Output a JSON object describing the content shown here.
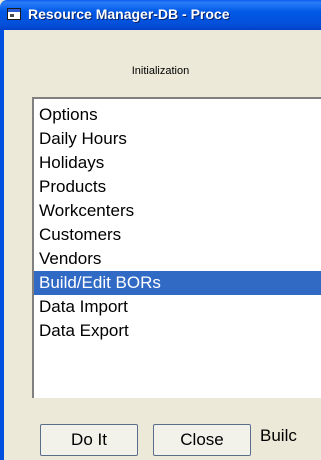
{
  "window": {
    "title": "Resource Manager-DB - Proce",
    "app_icon": "window-app-icon"
  },
  "header": {
    "label": "Initialization"
  },
  "list": {
    "items": [
      {
        "label": "Options",
        "selected": false
      },
      {
        "label": "Daily Hours",
        "selected": false
      },
      {
        "label": "Holidays",
        "selected": false
      },
      {
        "label": "Products",
        "selected": false
      },
      {
        "label": "Workcenters",
        "selected": false
      },
      {
        "label": "Customers",
        "selected": false
      },
      {
        "label": "Vendors",
        "selected": false
      },
      {
        "label": "Build/Edit BORs",
        "selected": true
      },
      {
        "label": "Data Import",
        "selected": false
      },
      {
        "label": "Data Export",
        "selected": false
      }
    ]
  },
  "buttons": {
    "do_it": "Do It",
    "close": "Close"
  },
  "status": {
    "text": "Builc"
  },
  "colors": {
    "titlebar": "#0058E6",
    "selection": "#316AC5",
    "face": "#ECE9D8"
  }
}
